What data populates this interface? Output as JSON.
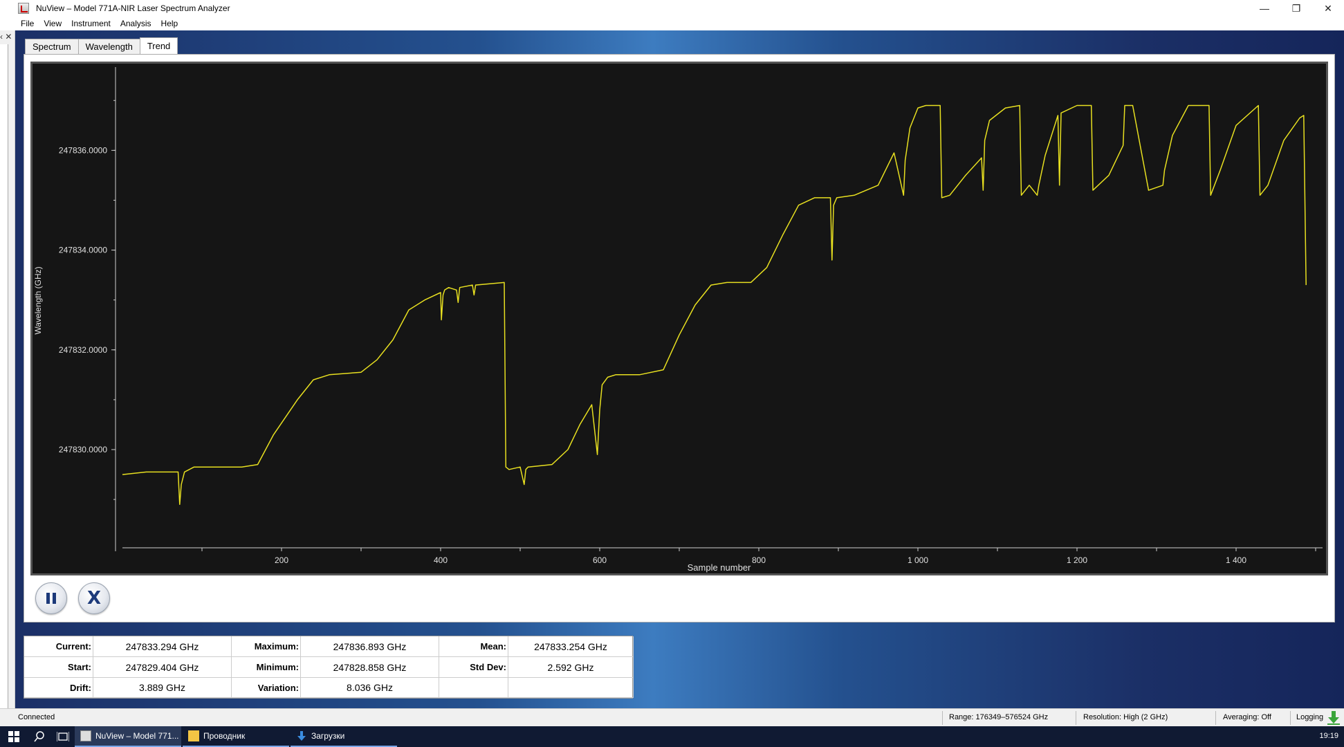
{
  "window": {
    "title": "NuView – Model 771A-NIR Laser Spectrum Analyzer",
    "controls": [
      "—",
      "❐",
      "✕"
    ]
  },
  "menu": [
    "File",
    "View",
    "Instrument",
    "Analysis",
    "Help"
  ],
  "left_dock": {
    "label": "‹ ✕"
  },
  "tabs": [
    {
      "label": "Spectrum",
      "active": false
    },
    {
      "label": "Wavelength",
      "active": false
    },
    {
      "label": "Trend",
      "active": true
    }
  ],
  "chart_data": {
    "type": "line",
    "xlabel": "Sample number",
    "ylabel": "Wavelength (GHz)",
    "x_ticks": [
      "200",
      "400",
      "600",
      "800",
      "1 000",
      "1 200",
      "1 400"
    ],
    "x_tick_values": [
      200,
      400,
      600,
      800,
      1000,
      1200,
      1400
    ],
    "y_ticks": [
      "247830.0000",
      "247832.0000",
      "247834.0000",
      "247836.0000"
    ],
    "y_tick_values": [
      247830,
      247832,
      247834,
      247836
    ],
    "xlim": [
      0,
      1500
    ],
    "ylim": [
      247828.1,
      247837.6
    ],
    "line_color": "#e8e020",
    "background": "#151515",
    "series": [
      {
        "x": [
          0,
          30,
          70,
          72,
          74,
          78,
          90,
          150,
          170,
          190,
          220,
          240,
          260,
          300,
          320,
          340,
          360,
          380,
          400,
          401,
          403,
          405,
          410,
          420,
          422,
          424,
          440,
          442,
          444,
          480,
          482,
          486,
          500,
          505,
          507,
          510,
          540,
          560,
          575,
          590,
          597,
          600,
          603,
          610,
          620,
          650,
          680,
          700,
          720,
          740,
          760,
          790,
          810,
          830,
          850,
          870,
          890,
          892,
          894,
          898,
          920,
          950,
          970,
          982,
          984,
          990,
          1000,
          1010,
          1028,
          1030,
          1040,
          1060,
          1080,
          1082,
          1084,
          1090,
          1110,
          1128,
          1130,
          1140,
          1150,
          1152,
          1160,
          1170,
          1176,
          1178,
          1180,
          1200,
          1218,
          1220,
          1240,
          1258,
          1260,
          1270,
          1290,
          1308,
          1310,
          1320,
          1340,
          1366,
          1368,
          1380,
          1400,
          1428,
          1430,
          1440,
          1460,
          1480,
          1485,
          1488
        ],
        "y": [
          247829.5,
          247829.55,
          247829.55,
          247828.9,
          247829.3,
          247829.55,
          247829.65,
          247829.65,
          247829.7,
          247830.3,
          247831.0,
          247831.4,
          247831.5,
          247831.55,
          247831.8,
          247832.2,
          247832.8,
          247833.0,
          247833.15,
          247832.6,
          247833.1,
          247833.2,
          247833.25,
          247833.2,
          247832.95,
          247833.25,
          247833.3,
          247833.1,
          247833.3,
          247833.35,
          247829.65,
          247829.6,
          247829.65,
          247829.3,
          247829.6,
          247829.65,
          247829.7,
          247830.0,
          247830.5,
          247830.9,
          247829.9,
          247830.8,
          247831.3,
          247831.45,
          247831.5,
          247831.5,
          247831.6,
          247832.3,
          247832.9,
          247833.3,
          247833.35,
          247833.35,
          247833.65,
          247834.3,
          247834.9,
          247835.05,
          247835.05,
          247833.8,
          247834.9,
          247835.05,
          247835.1,
          247835.3,
          247835.95,
          247835.1,
          247835.8,
          247836.45,
          247836.85,
          247836.9,
          247836.9,
          247835.05,
          247835.1,
          247835.5,
          247835.85,
          247835.2,
          247836.2,
          247836.6,
          247836.85,
          247836.9,
          247835.1,
          247835.3,
          247835.1,
          247835.3,
          247835.9,
          247836.4,
          247836.7,
          247835.3,
          247836.75,
          247836.9,
          247836.9,
          247835.2,
          247835.5,
          247836.1,
          247836.9,
          247836.9,
          247835.2,
          247835.3,
          247835.6,
          247836.3,
          247836.9,
          247836.9,
          247835.1,
          247835.6,
          247836.5,
          247836.9,
          247835.1,
          247835.3,
          247836.2,
          247836.65,
          247836.7,
          247833.3
        ]
      }
    ]
  },
  "controls": {
    "pause_label": "pause",
    "stop_label": "X"
  },
  "stats": {
    "current_label": "Current:",
    "current": "247833.294 GHz",
    "maximum_label": "Maximum:",
    "maximum": "247836.893 GHz",
    "mean_label": "Mean:",
    "mean": "247833.254 GHz",
    "start_label": "Start:",
    "start": "247829.404 GHz",
    "minimum_label": "Minimum:",
    "minimum": "247828.858 GHz",
    "stddev_label": "Std Dev:",
    "stddev": "2.592 GHz",
    "drift_label": "Drift:",
    "drift": "3.889 GHz",
    "variation_label": "Variation:",
    "variation": "8.036 GHz"
  },
  "statusbar": {
    "connection": "Connected",
    "range": "Range:   176349–576524 GHz",
    "resolution": "Resolution:  High (2 GHz)",
    "averaging": "Averaging:  Off",
    "logging": "Logging"
  },
  "taskbar": {
    "apps": [
      {
        "label": "NuView – Model 771...",
        "active": true
      },
      {
        "label": "Проводник",
        "active": false
      },
      {
        "label": "Загрузки",
        "active": false
      }
    ],
    "clock": "19:19"
  }
}
